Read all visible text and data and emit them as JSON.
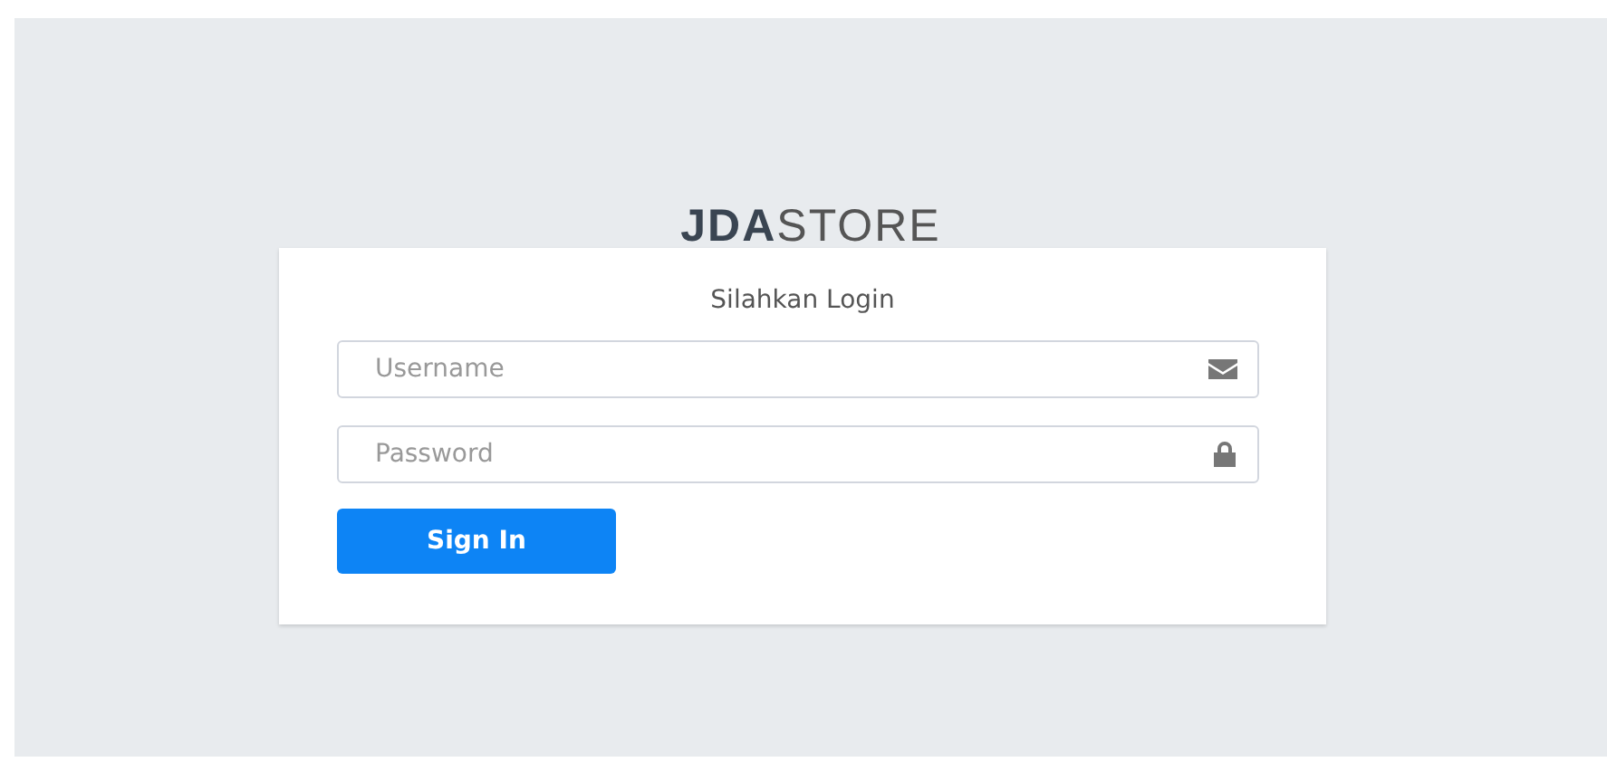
{
  "logo": "**JDA**STORE",
  "card": {
    "title": "Silahkan Login"
  },
  "fields": [
    {
      "kind": "email",
      "placeholder": "Username"
    },
    {
      "kind": "lock",
      "placeholder": "Password"
    }
  ],
  "button": "Sign In"
}
